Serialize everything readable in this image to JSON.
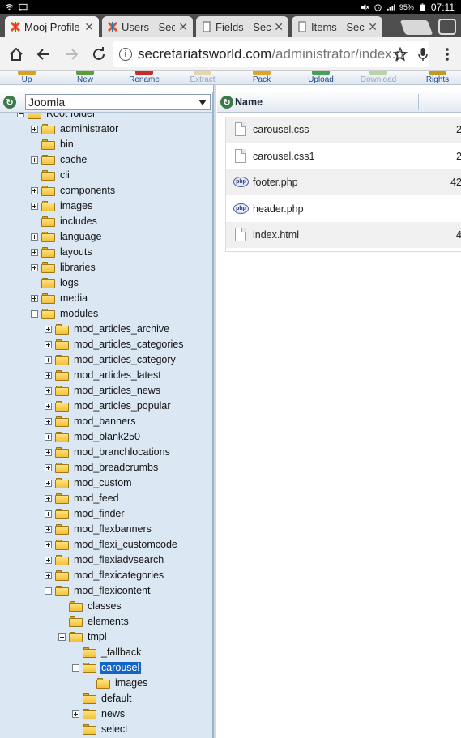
{
  "status_bar": {
    "time": "07:11",
    "battery": "95%",
    "icons_left": [
      "wifi-icon",
      "cast-icon"
    ],
    "icons_right": [
      "mute-icon",
      "alarm-icon",
      "signal-icon",
      "battery-icon"
    ]
  },
  "tabs": [
    {
      "title": "Mooj Profile",
      "favicon": "joomla-icon",
      "active": true
    },
    {
      "title": "Users - Secr",
      "favicon": "joomla-icon",
      "active": false
    },
    {
      "title": "Fields - Secr",
      "favicon": "page-icon",
      "active": false
    },
    {
      "title": "Items - Secr",
      "favicon": "page-icon",
      "active": false
    }
  ],
  "address_bar": {
    "host": "secretariatsworld.com",
    "path": "/administrator/index.p"
  },
  "toolbar": {
    "items": [
      {
        "label": "Up",
        "disabled": false
      },
      {
        "label": "New",
        "disabled": false
      },
      {
        "label": "Rename",
        "disabled": false
      },
      {
        "label": "Extract",
        "disabled": true
      },
      {
        "label": "Pack",
        "disabled": false
      },
      {
        "label": "Upload",
        "disabled": false
      },
      {
        "label": "Download",
        "disabled": true
      },
      {
        "label": "Rights",
        "disabled": false
      }
    ]
  },
  "left_panel": {
    "selector_value": "Joomla",
    "tree": [
      {
        "label": "Root folder",
        "level": 0,
        "expander": "minus"
      },
      {
        "label": "administrator",
        "level": 1,
        "expander": "plus"
      },
      {
        "label": "bin",
        "level": 1,
        "expander": ""
      },
      {
        "label": "cache",
        "level": 1,
        "expander": "plus"
      },
      {
        "label": "cli",
        "level": 1,
        "expander": ""
      },
      {
        "label": "components",
        "level": 1,
        "expander": "plus"
      },
      {
        "label": "images",
        "level": 1,
        "expander": "plus"
      },
      {
        "label": "includes",
        "level": 1,
        "expander": ""
      },
      {
        "label": "language",
        "level": 1,
        "expander": "plus"
      },
      {
        "label": "layouts",
        "level": 1,
        "expander": "plus"
      },
      {
        "label": "libraries",
        "level": 1,
        "expander": "plus"
      },
      {
        "label": "logs",
        "level": 1,
        "expander": ""
      },
      {
        "label": "media",
        "level": 1,
        "expander": "plus"
      },
      {
        "label": "modules",
        "level": 1,
        "expander": "minus"
      },
      {
        "label": "mod_articles_archive",
        "level": 2,
        "expander": "plus"
      },
      {
        "label": "mod_articles_categories",
        "level": 2,
        "expander": "plus"
      },
      {
        "label": "mod_articles_category",
        "level": 2,
        "expander": "plus"
      },
      {
        "label": "mod_articles_latest",
        "level": 2,
        "expander": "plus"
      },
      {
        "label": "mod_articles_news",
        "level": 2,
        "expander": "plus"
      },
      {
        "label": "mod_articles_popular",
        "level": 2,
        "expander": "plus"
      },
      {
        "label": "mod_banners",
        "level": 2,
        "expander": "plus"
      },
      {
        "label": "mod_blank250",
        "level": 2,
        "expander": "plus"
      },
      {
        "label": "mod_branchlocations",
        "level": 2,
        "expander": "plus"
      },
      {
        "label": "mod_breadcrumbs",
        "level": 2,
        "expander": "plus"
      },
      {
        "label": "mod_custom",
        "level": 2,
        "expander": "plus"
      },
      {
        "label": "mod_feed",
        "level": 2,
        "expander": "plus"
      },
      {
        "label": "mod_finder",
        "level": 2,
        "expander": "plus"
      },
      {
        "label": "mod_flexbanners",
        "level": 2,
        "expander": "plus"
      },
      {
        "label": "mod_flexi_customcode",
        "level": 2,
        "expander": "plus"
      },
      {
        "label": "mod_flexiadvsearch",
        "level": 2,
        "expander": "plus"
      },
      {
        "label": "mod_flexicategories",
        "level": 2,
        "expander": "plus"
      },
      {
        "label": "mod_flexicontent",
        "level": 2,
        "expander": "minus"
      },
      {
        "label": "classes",
        "level": 3,
        "expander": ""
      },
      {
        "label": "elements",
        "level": 3,
        "expander": ""
      },
      {
        "label": "tmpl",
        "level": 3,
        "expander": "minus"
      },
      {
        "label": "_fallback",
        "level": 4,
        "expander": ""
      },
      {
        "label": "carousel",
        "level": 4,
        "expander": "minus",
        "selected": true
      },
      {
        "label": "images",
        "level": 5,
        "expander": ""
      },
      {
        "label": "default",
        "level": 4,
        "expander": ""
      },
      {
        "label": "news",
        "level": 4,
        "expander": "plus"
      },
      {
        "label": "select",
        "level": 4,
        "expander": ""
      }
    ]
  },
  "right_panel": {
    "column_name": "Name",
    "files": [
      {
        "name": "carousel.css",
        "type": "file",
        "size": "2"
      },
      {
        "name": "carousel.css1",
        "type": "file",
        "size": "2"
      },
      {
        "name": "footer.php",
        "type": "php",
        "size": "42"
      },
      {
        "name": "header.php",
        "type": "php",
        "size": ""
      },
      {
        "name": "index.html",
        "type": "file",
        "size": "4"
      }
    ]
  }
}
